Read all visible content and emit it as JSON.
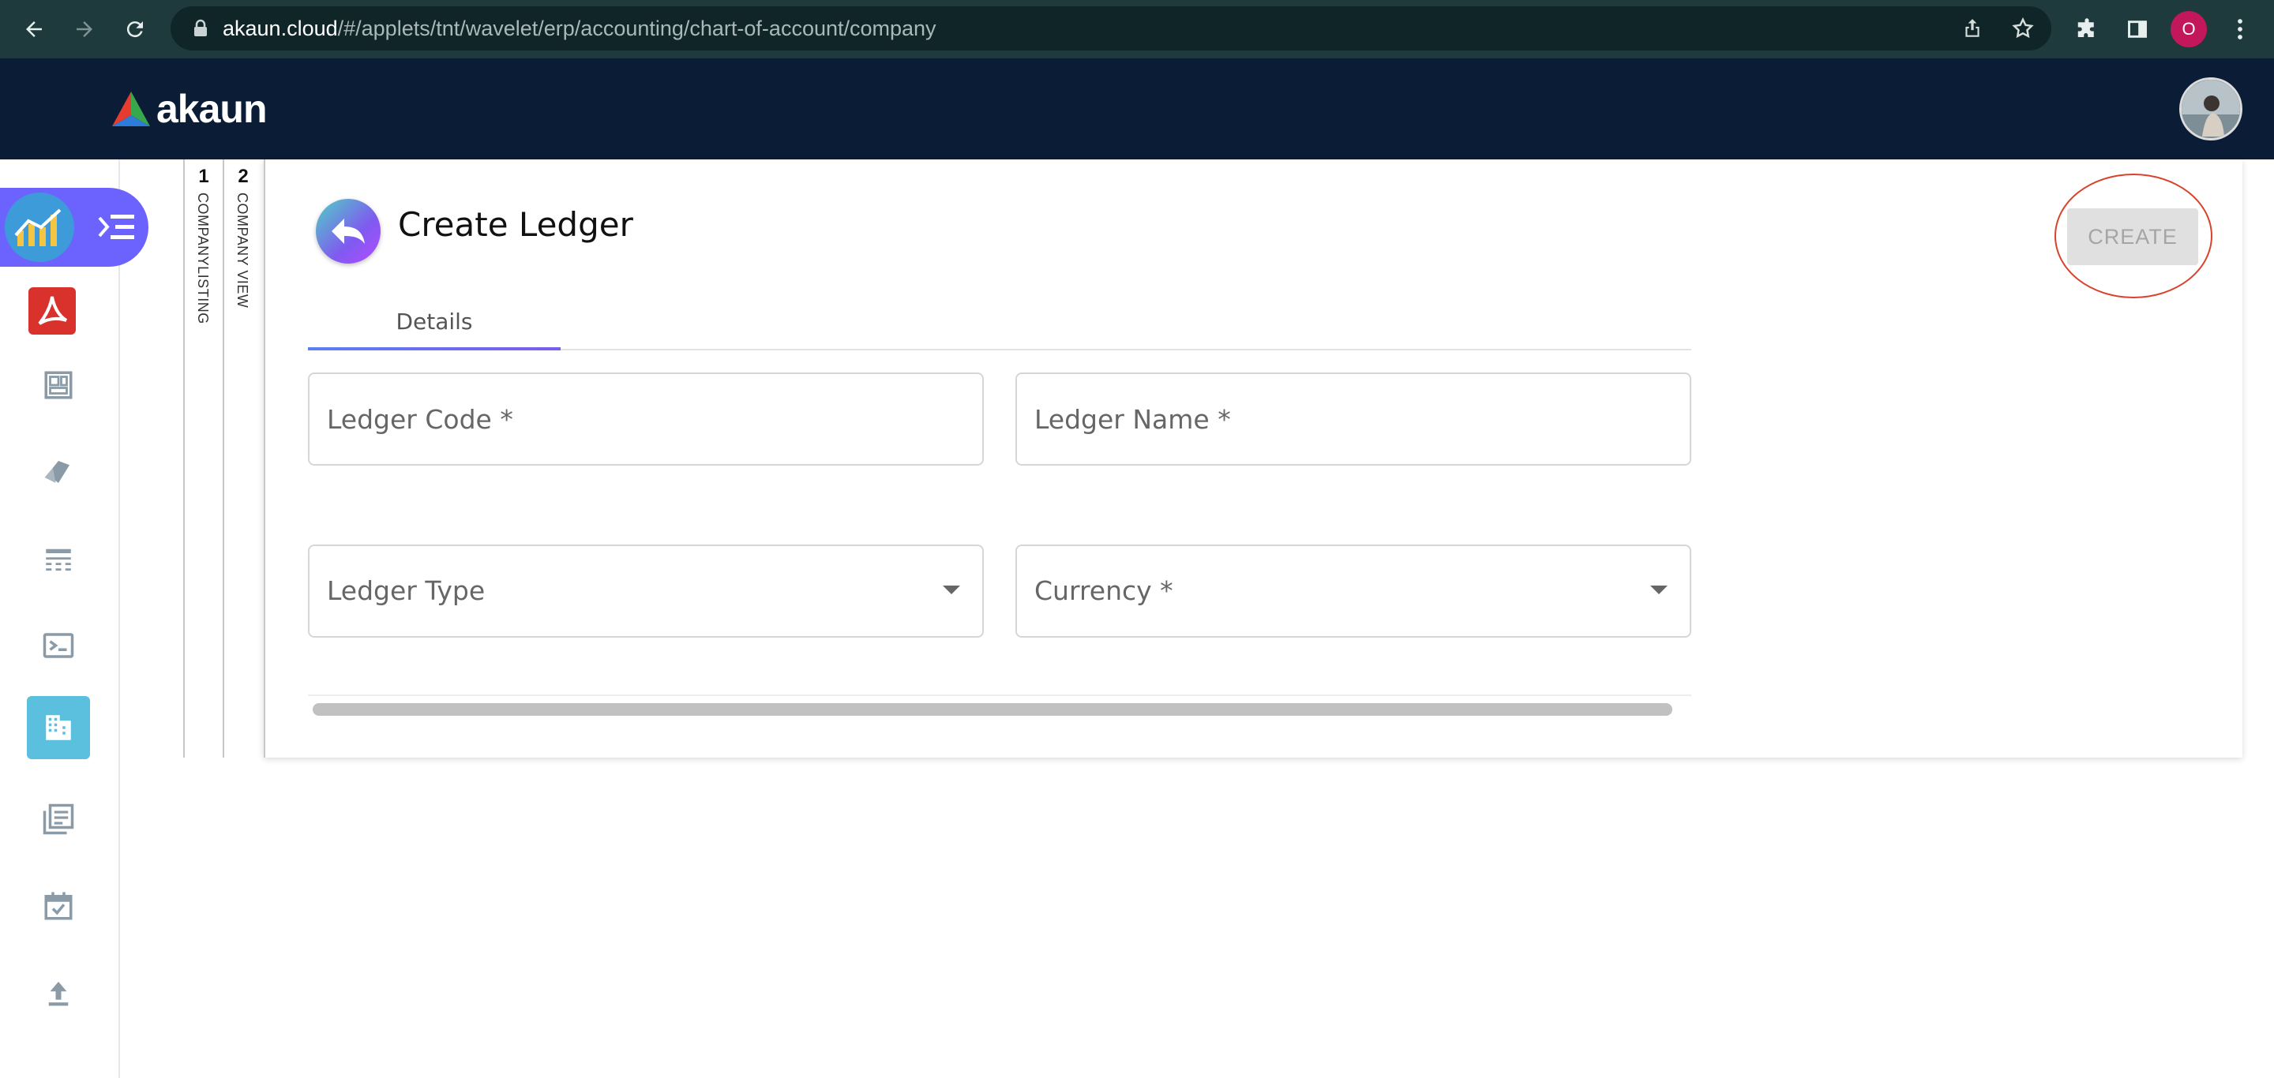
{
  "browser": {
    "url_host": "akaun.cloud",
    "url_path": "/#/applets/tnt/wavelet/erp/accounting/chart-of-account/company",
    "profile_initial": "O"
  },
  "header": {
    "brand_name": "akaun"
  },
  "breadcrumb_tabs": [
    {
      "number": "1",
      "label": "COMPANYLISTING"
    },
    {
      "number": "2",
      "label": "COMPANY VIEW"
    }
  ],
  "page": {
    "title": "Create Ledger",
    "create_label": "CREATE"
  },
  "tabs": [
    {
      "label": "Details",
      "active": true
    }
  ],
  "form": {
    "ledger_code_placeholder": "Ledger Code *",
    "ledger_name_placeholder": "Ledger Name *",
    "ledger_type_label": "Ledger Type",
    "currency_label": "Currency *"
  },
  "colors": {
    "browser_bar": "#1e3a3c",
    "app_header": "#0b1d36",
    "accent": "#6c63ff",
    "active_rail": "#5bc0de",
    "highlight": "#d9422b"
  },
  "icons": {
    "rail": [
      "analytics-app-icon",
      "menu-toggle-icon",
      "acrobat-icon",
      "dashboard-icon",
      "tags-icon",
      "table-icon",
      "terminal-icon",
      "company-icon",
      "ledger-book-icon",
      "calendar-check-icon",
      "upload-icon"
    ]
  }
}
